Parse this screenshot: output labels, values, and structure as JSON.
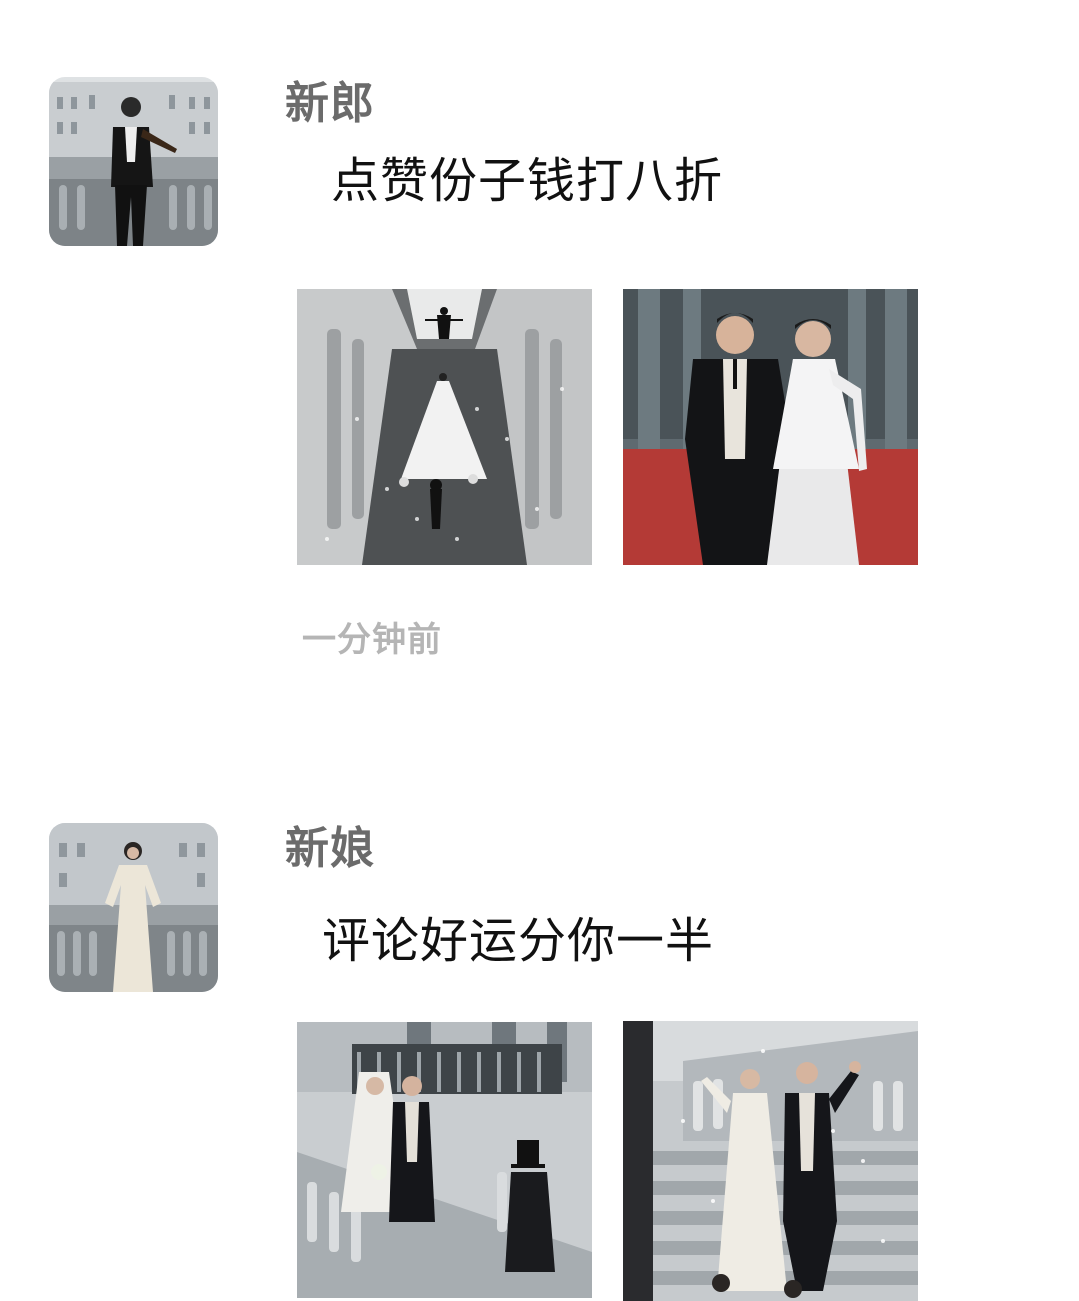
{
  "feed": [
    {
      "author": "新郎",
      "caption": "点赞份子钱打八折",
      "timestamp": "一分钟前",
      "avatar_icon": "groom-violin-avatar",
      "photos": [
        {
          "icon": "aerial-staircase-wedding-photo"
        },
        {
          "icon": "couple-red-carpet-photo"
        }
      ]
    },
    {
      "author": "新娘",
      "caption": "评论好运分你一半",
      "avatar_icon": "bride-balcony-avatar",
      "photos": [
        {
          "icon": "couple-on-stairs-photo"
        },
        {
          "icon": "couple-waving-stairs-photo"
        }
      ]
    }
  ],
  "colors": {
    "author": "#6b6b6b",
    "caption": "#111111",
    "timestamp": "#b5b5b5",
    "red_carpet": "#b43a36"
  }
}
